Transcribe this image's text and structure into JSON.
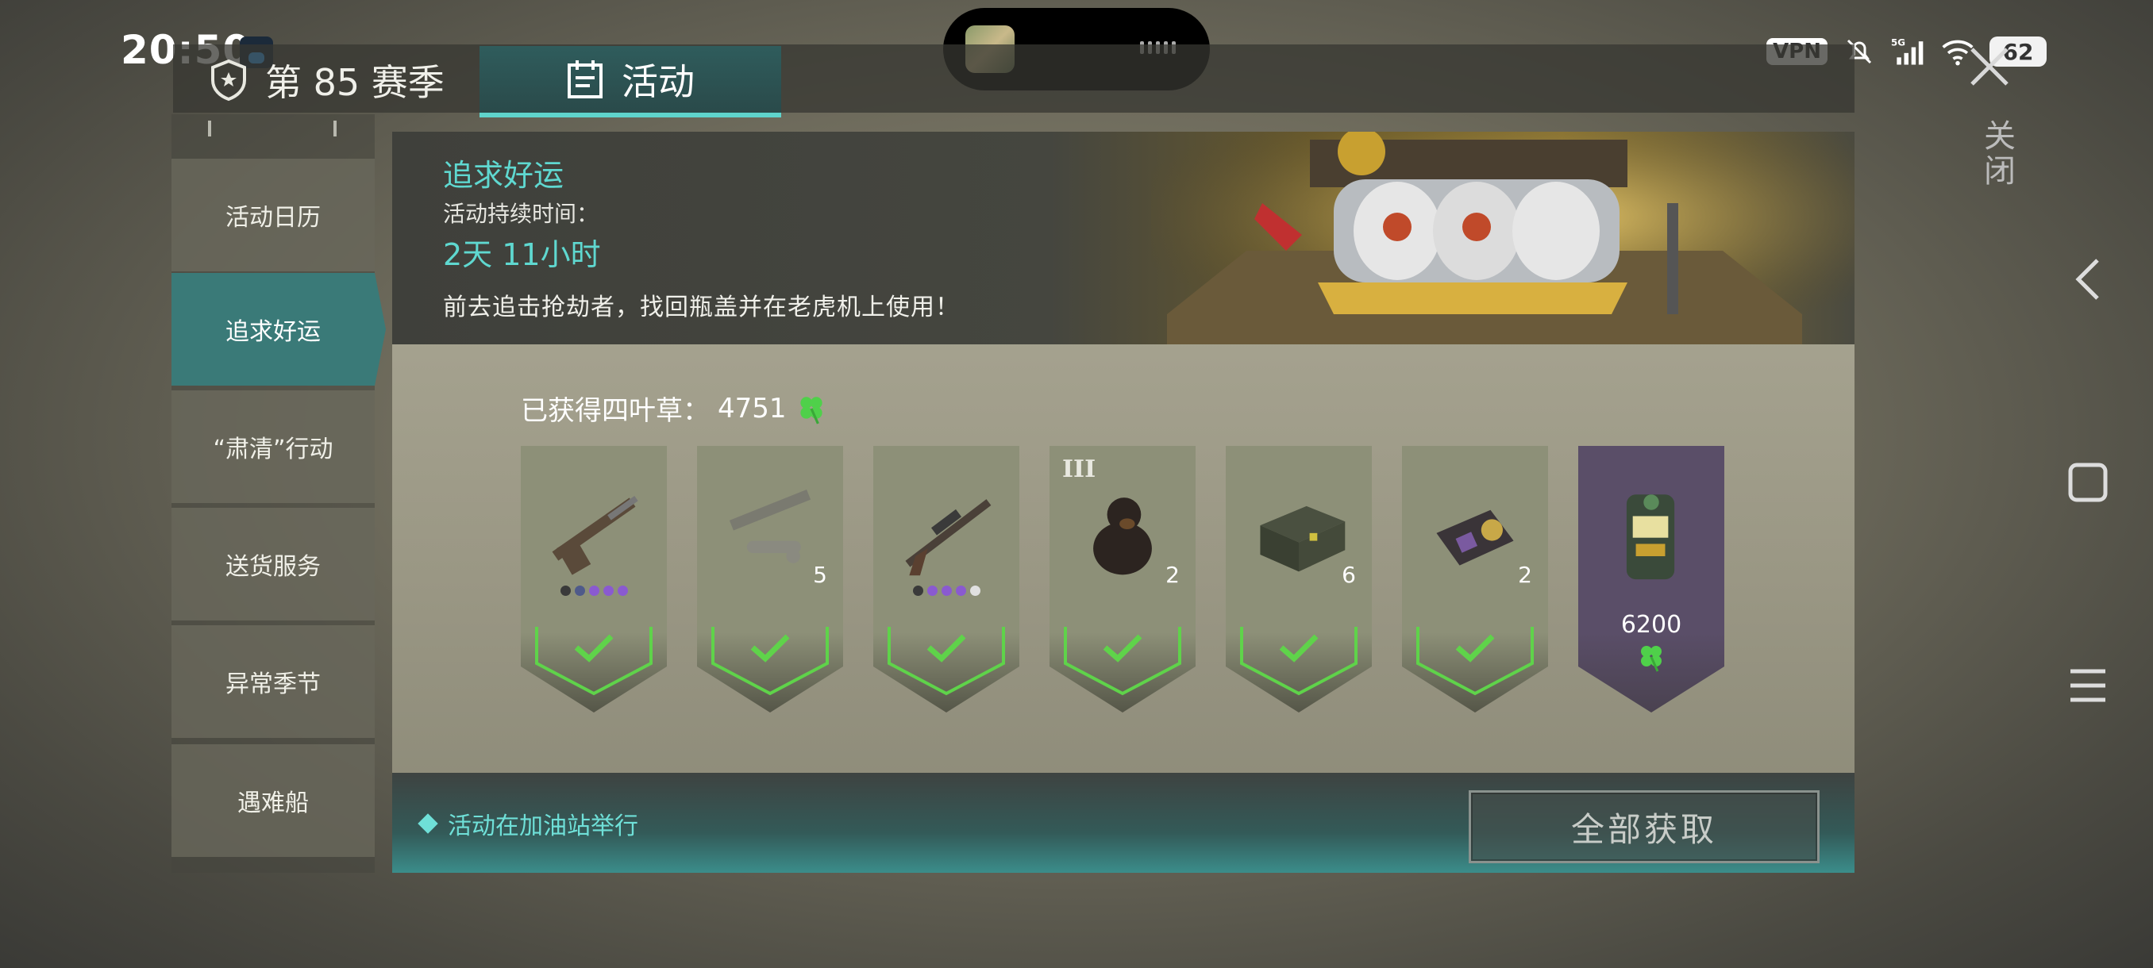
{
  "status_bar": {
    "time": "20:50",
    "vpn": "VPN",
    "network": "5G",
    "battery": "62"
  },
  "header": {
    "season_tab": "第 85 赛季",
    "activity_tab": "活动",
    "close_label": "关闭"
  },
  "sidebar": {
    "items": [
      {
        "label": "活动日历"
      },
      {
        "label": "追求好运"
      },
      {
        "label": "“肃清”行动"
      },
      {
        "label": "送货服务"
      },
      {
        "label": "异常季节"
      },
      {
        "label": "遇难船"
      }
    ],
    "active_index": 1
  },
  "banner": {
    "title": "追求好运",
    "duration_label": "活动持续时间：",
    "duration": "2天 11小时",
    "description": "前去追击抢劫者，找回瓶盖并在老虎机上使用！"
  },
  "progress": {
    "label": "已获得四叶草：",
    "value": "4751"
  },
  "rewards": [
    {
      "icon": "shotgun-icon",
      "qty": "",
      "rarity_dots": [
        "#3a3a3a",
        "#4f5a8a",
        "#8a5ad0",
        "#8a5ad0",
        "#8a5ad0"
      ],
      "claimed": true
    },
    {
      "icon": "rocket-launcher-icon",
      "qty": "5",
      "claimed": true
    },
    {
      "icon": "assault-rifle-icon",
      "qty": "",
      "rarity_dots": [
        "#3a3a3a",
        "#8a5ad0",
        "#8a5ad0",
        "#8a5ad0",
        "#e0e0e0"
      ],
      "claimed": true
    },
    {
      "icon": "rottweiler-dog-icon",
      "qty": "2",
      "tier": "III",
      "claimed": true
    },
    {
      "icon": "supply-crate-icon",
      "qty": "6",
      "claimed": true
    },
    {
      "icon": "police-badge-icon",
      "qty": "2",
      "claimed": true
    },
    {
      "icon": "slot-machine-icon",
      "price": "6200",
      "claimed": false
    }
  ],
  "footer": {
    "note": "活动在加油站举行",
    "claim_all": "全部获取"
  },
  "colors": {
    "accent_teal": "#5fd8d0",
    "claimed_green": "#5fd34a",
    "clover_green": "#4fd04a"
  }
}
